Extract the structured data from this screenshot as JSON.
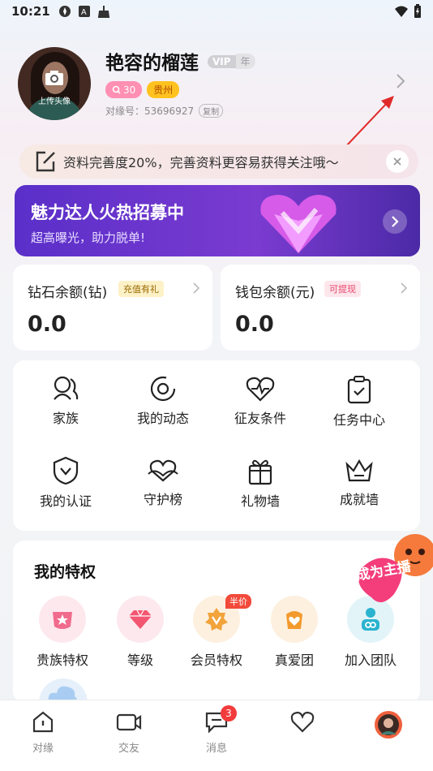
{
  "status_bar": {
    "time": "10:21"
  },
  "profile": {
    "nickname": "艳容的榴莲",
    "vip_label": "VIP",
    "vip_suffix": "年",
    "age": "30",
    "city": "贵州",
    "id_label": "对缘号：",
    "id_value": "53696927",
    "copy_label": "复制",
    "upload_avatar": "上传头像"
  },
  "completion_banner": {
    "text": "资料完善度20%，完善资料更容易获得关注哦～"
  },
  "promo": {
    "title": "魅力达人火热招募中",
    "subtitle": "超高曝光，助力脱单!"
  },
  "balances": [
    {
      "label": "钻石余额(钻)",
      "tag": "充值有礼",
      "amount": "0.0"
    },
    {
      "label": "钱包余额(元)",
      "tag": "可提现",
      "amount": "0.0"
    }
  ],
  "features": [
    {
      "label": "家族",
      "icon": "family-icon"
    },
    {
      "label": "我的动态",
      "icon": "moments-icon"
    },
    {
      "label": "征友条件",
      "icon": "heart-pulse-icon"
    },
    {
      "label": "任务中心",
      "icon": "task-icon"
    },
    {
      "label": "我的认证",
      "icon": "verify-icon"
    },
    {
      "label": "守护榜",
      "icon": "guard-icon"
    },
    {
      "label": "礼物墙",
      "icon": "gift-icon"
    },
    {
      "label": "成就墙",
      "icon": "crown-icon"
    }
  ],
  "privileges": {
    "title": "我的特权",
    "items": [
      {
        "label": "贵族特权",
        "icon": "noble-icon"
      },
      {
        "label": "等级",
        "icon": "diamond-level-icon"
      },
      {
        "label": "会员特权",
        "icon": "vip-icon",
        "badge": "半价"
      },
      {
        "label": "真爱团",
        "icon": "love-group-icon"
      },
      {
        "label": "加入团队",
        "icon": "join-team-icon"
      }
    ]
  },
  "become_anchor": "成为主播",
  "tabbar": [
    {
      "label": "对缘",
      "icon": "home-icon"
    },
    {
      "label": "交友",
      "icon": "video-icon"
    },
    {
      "label": "消息",
      "icon": "message-icon",
      "badge": "3"
    },
    {
      "label": "",
      "icon": "heart-icon"
    },
    {
      "label": "",
      "icon": "avatar-tab-icon"
    }
  ],
  "colors": {
    "accent_pink": "#ff8fb3",
    "city_yellow": "#ffc21f",
    "promo_purple": "#6a35cc",
    "badge_red": "#f23b3b"
  }
}
